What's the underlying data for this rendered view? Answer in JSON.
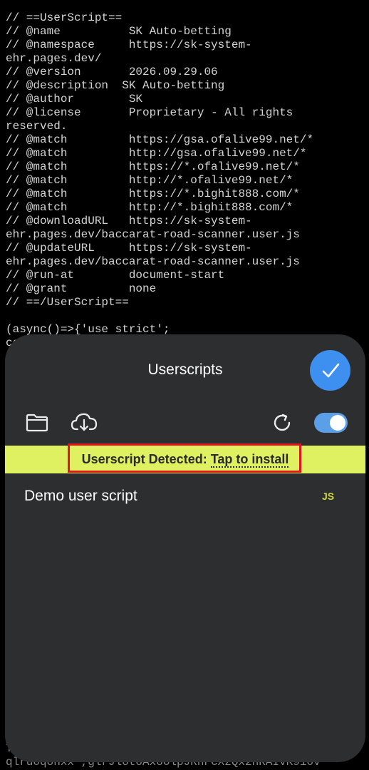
{
  "code_editor": {
    "header_text": "// ==UserScript==\n// @name          SK Auto-betting\n// @namespace     https://sk-system-\nehr.pages.dev/\n// @version       2026.09.29.06\n// @description  SK Auto-betting\n// @author        SK\n// @license       Proprietary - All rights\nreserved.\n// @match         https://gsa.ofalive99.net/*\n// @match         http://gsa.ofalive99.net/*\n// @match         https://*.ofalive99.net/*\n// @match         http://*.ofalive99.net/*\n// @match         https://*.bighit888.com/*\n// @match         http://*.bighit888.com/*\n// @downloadURL   https://sk-system-\nehr.pages.dev/baccarat-road-scanner.user.js\n// @updateURL     https://sk-system-\nehr.pages.dev/baccarat-road-scanner.user.js\n// @run-at        document-start\n// @grant         none\n// ==/UserScript==\n\n(async()=>{'use strict';\nco\nc",
    "footer_text": "Tu\nqlru0qonxx',glrJlotoAxoOlpJRnFCXzQx2nRAIvK910v"
  },
  "panel": {
    "title": "Userscripts",
    "done_icon": "checkmark-icon",
    "toolbar": {
      "folder_icon": "folder-icon",
      "cloud_icon": "cloud-download-icon",
      "refresh_icon": "refresh-icon",
      "toggle_state": "on"
    },
    "banner": {
      "prefix": "Userscript Detected: ",
      "link": "Tap to install",
      "background": "#dff060",
      "highlight_color": "#e0141e"
    },
    "scripts": [
      {
        "name": "Demo user script",
        "badge": "JS"
      }
    ],
    "accent_color": "#3d8ff0"
  }
}
